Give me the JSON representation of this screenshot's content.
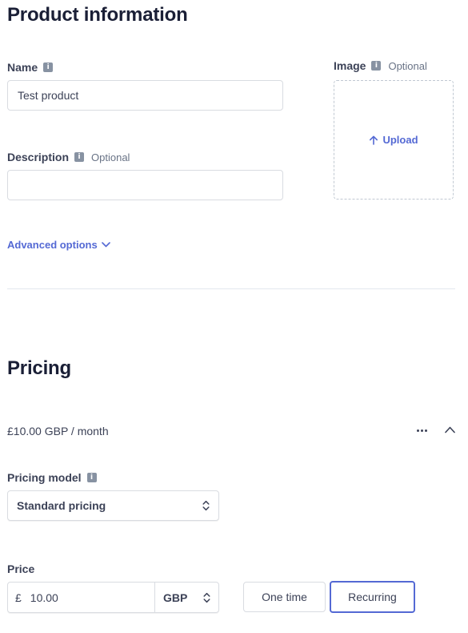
{
  "product_section": {
    "title": "Product information",
    "name_label": "Name",
    "name_value": "Test product",
    "description_label": "Description",
    "description_optional": "Optional",
    "description_value": "",
    "image_label": "Image",
    "image_optional": "Optional",
    "upload_label": "Upload",
    "advanced_options_label": "Advanced options"
  },
  "pricing_section": {
    "title": "Pricing",
    "price_summary": "£10.00 GBP / month",
    "pricing_model_label": "Pricing model",
    "pricing_model_value": "Standard pricing",
    "price_label": "Price",
    "currency_symbol": "£",
    "price_value": "10.00",
    "currency_code": "GBP",
    "one_time_label": "One time",
    "recurring_label": "Recurring",
    "selected_billing": "Recurring"
  },
  "colors": {
    "accent": "#5469d4",
    "text_primary": "#1a1f36",
    "text_secondary": "#697386",
    "border": "#d9dce1"
  }
}
